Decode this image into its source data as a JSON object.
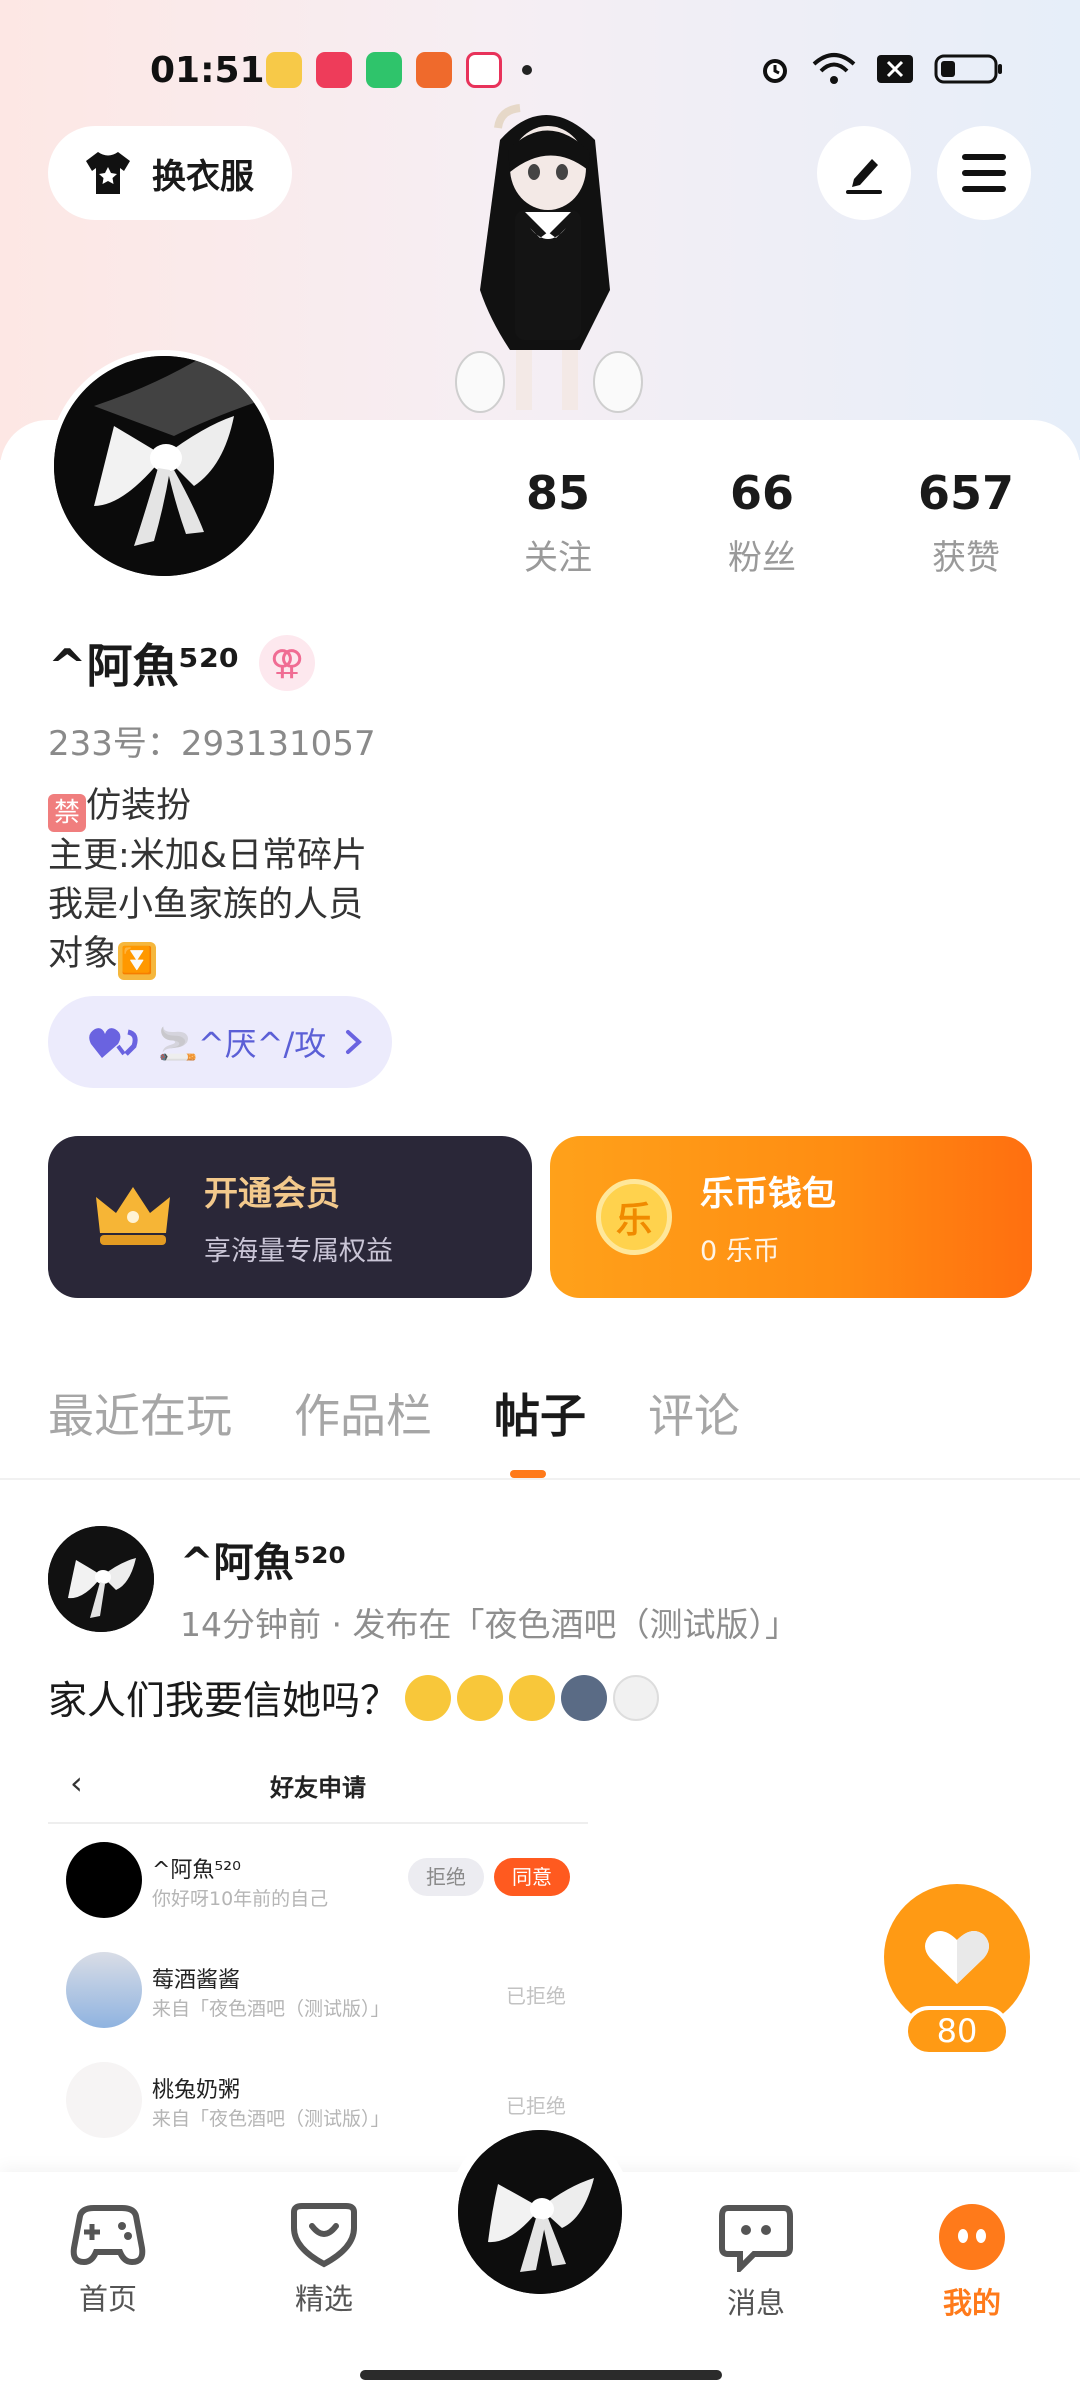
{
  "status_bar": {
    "time": "01:51"
  },
  "header": {
    "outfit_label": "换衣服"
  },
  "profile": {
    "nickname": "^阿魚⁵²⁰",
    "gender_symbol": "⚢",
    "uid": "233号：293131057",
    "bio_lines": [
      {
        "badge": "禁",
        "text": "仿装扮"
      },
      {
        "text": "主更:米加&日常碎片"
      },
      {
        "text": "我是小鱼家族的人员"
      },
      {
        "text": "对象",
        "suffix_badge": "⏬"
      }
    ],
    "stats": [
      {
        "value": "85",
        "label": "关注"
      },
      {
        "value": "66",
        "label": "粉丝"
      },
      {
        "value": "657",
        "label": "获赞"
      }
    ],
    "cp_label": "🚬^厌^/攻"
  },
  "vip": {
    "title": "开通会员",
    "subtitle": "享海量专属权益"
  },
  "wallet": {
    "title": "乐币钱包",
    "subtitle": "0 乐币",
    "coin_char": "乐"
  },
  "tabs": [
    {
      "label": "最近在玩",
      "active": false
    },
    {
      "label": "作品栏",
      "active": false
    },
    {
      "label": "帖子",
      "active": true
    },
    {
      "label": "评论",
      "active": false
    }
  ],
  "post": {
    "author": "^阿魚⁵²⁰",
    "meta": "14分钟前 · 发布在「夜色酒吧（测试版）」",
    "text": "家人们我要信她吗？",
    "screenshot": {
      "title": "好友申请",
      "requests": [
        {
          "name": "^阿魚⁵²⁰",
          "sub": "你好呀10年前的自己",
          "reject": "拒绝",
          "accept": "同意"
        },
        {
          "name": "莓酒酱酱",
          "sub": "来自「夜色酒吧（测试版）」",
          "status": "已拒绝"
        },
        {
          "name": "桃兔奶粥",
          "sub": "来自「夜色酒吧（测试版）」",
          "status": "已拒绝"
        }
      ]
    }
  },
  "like_fab": {
    "count": "80"
  },
  "bottom_nav": [
    {
      "label": "首页"
    },
    {
      "label": "精选"
    },
    {
      "label": "消息"
    },
    {
      "label": "我的",
      "active": true
    }
  ],
  "colors": {
    "accent": "#ff7a1a",
    "vip_bg": "#2a2738",
    "wallet_bg": "#ff9a14",
    "cp_text": "#5b5fd6"
  }
}
